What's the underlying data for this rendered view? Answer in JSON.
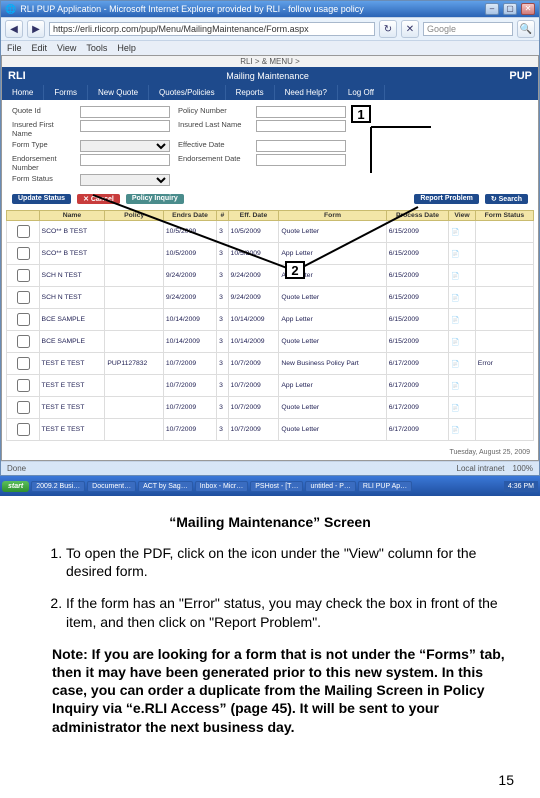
{
  "browser": {
    "title": "RLI PUP Application - Microsoft Internet Explorer provided by RLI - follow usage policy",
    "menus": [
      "File",
      "Edit",
      "View",
      "Tools",
      "Help"
    ],
    "url": "https://erli.rlicorp.com/pup/Menu/MailingMaintenance/Form.aspx",
    "search_placeholder": "Google"
  },
  "app": {
    "brand_left": "RLI",
    "brand_mid": "Mailing Maintenance",
    "brand_right": "PUP",
    "breadcrumb": "RLI > & MENU >",
    "tabs": [
      "Home",
      "Forms",
      "New Quote",
      "Quotes/Policies",
      "Reports",
      "Need Help?",
      "Log Off"
    ],
    "filters": {
      "l1": "Quote Id",
      "l2": "Policy Number",
      "l3": "Insured First Name",
      "l4": "Insured Last Name",
      "l5": "Form Type",
      "l6": "Effective Date",
      "l7": "Endorsement Number",
      "l8": "Endorsement Date",
      "l9": "Form Status"
    },
    "buttons": {
      "update": "Update Status",
      "cancel": "✕ Cancel",
      "policy": "Policy Inquiry",
      "report": "Report Problem",
      "search": "↻ Search"
    },
    "cols": [
      "",
      "Name",
      "Policy",
      "Endrs Date",
      "#",
      "Eff. Date",
      "Form",
      "Process Date",
      "View",
      "Form Status"
    ],
    "rows": [
      {
        "name": "SCO** B TEST",
        "policy": "",
        "ed": "10/5/2009",
        "n": "3",
        "dt": "10/5/2009",
        "form": "Quote Letter",
        "pd": "6/15/2009",
        "view": "📄",
        "status": ""
      },
      {
        "name": "SCO** B TEST",
        "policy": "",
        "ed": "10/5/2009",
        "n": "3",
        "dt": "10/5/2009",
        "form": "App Letter",
        "pd": "6/15/2009",
        "view": "📄",
        "status": ""
      },
      {
        "name": "SCH N TEST",
        "policy": "",
        "ed": "9/24/2009",
        "n": "3",
        "dt": "9/24/2009",
        "form": "App Letter",
        "pd": "6/15/2009",
        "view": "📄",
        "status": ""
      },
      {
        "name": "SCH N TEST",
        "policy": "",
        "ed": "9/24/2009",
        "n": "3",
        "dt": "9/24/2009",
        "form": "Quote Letter",
        "pd": "6/15/2009",
        "view": "📄",
        "status": ""
      },
      {
        "name": "BCE SAMPLE",
        "policy": "",
        "ed": "10/14/2009",
        "n": "3",
        "dt": "10/14/2009",
        "form": "App Letter",
        "pd": "6/15/2009",
        "view": "📄",
        "status": ""
      },
      {
        "name": "BCE SAMPLE",
        "policy": "",
        "ed": "10/14/2009",
        "n": "3",
        "dt": "10/14/2009",
        "form": "Quote Letter",
        "pd": "6/15/2009",
        "view": "📄",
        "status": ""
      },
      {
        "name": "TEST E TEST",
        "policy": "PUP1127832",
        "ed": "10/7/2009",
        "n": "3",
        "dt": "10/7/2009",
        "form": "New Business Policy Part",
        "pd": "6/17/2009",
        "view": "📄",
        "status": "Error"
      },
      {
        "name": "TEST E TEST",
        "policy": "",
        "ed": "10/7/2009",
        "n": "3",
        "dt": "10/7/2009",
        "form": "App Letter",
        "pd": "6/17/2009",
        "view": "📄",
        "status": ""
      },
      {
        "name": "TEST E TEST",
        "policy": "",
        "ed": "10/7/2009",
        "n": "3",
        "dt": "10/7/2009",
        "form": "Quote Letter",
        "pd": "6/17/2009",
        "view": "📄",
        "status": ""
      },
      {
        "name": "TEST E TEST",
        "policy": "",
        "ed": "10/7/2009",
        "n": "3",
        "dt": "10/7/2009",
        "form": "Quote Letter",
        "pd": "6/17/2009",
        "view": "📄",
        "status": ""
      }
    ],
    "status_line": "Tuesday, August 25, 2009"
  },
  "ie_status": {
    "left": "Done",
    "right": "Local intranet",
    "zoom": "100%"
  },
  "callouts": {
    "one": "1",
    "two": "2"
  },
  "taskbar": {
    "start": "start",
    "items": [
      "2009.2 Busi…",
      "Document…",
      "ACT by Sag…",
      "Inbox - Micr…",
      "PSHost - [T…",
      "untitled - P…",
      "RLI PUP Ap…"
    ],
    "time": "4:36 PM"
  },
  "doc": {
    "caption": "“Mailing Maintenance” Screen",
    "step1": "To open the PDF, click on the icon under the \"View\" column for the desired form.",
    "step2": "If the form has an \"Error\" status, you may check the box in front of the item, and then click on \"Report Problem\".",
    "note": "Note:  If you are looking for a form that is not under the “Forms” tab, then it may have been generated prior to this new system. In this case, you can order a duplicate from the Mailing Screen in Policy Inquiry via “e.RLI Access” (page 45). It will be sent to your administrator the next business day.",
    "page": "15"
  }
}
